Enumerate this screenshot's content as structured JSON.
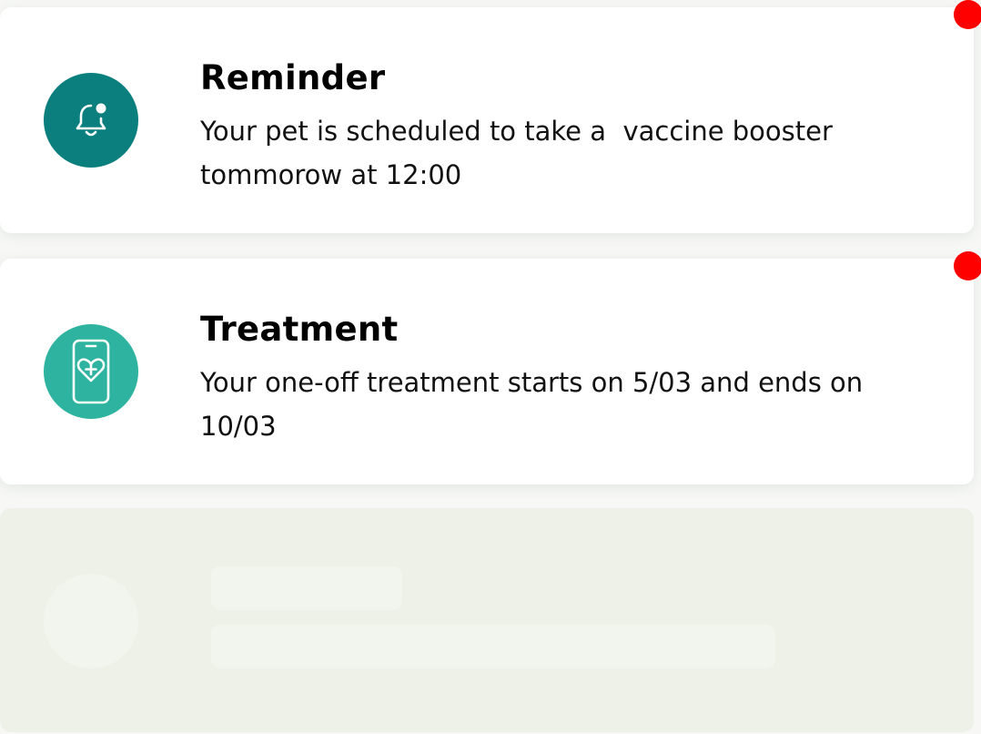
{
  "notifications": [
    {
      "title": "Reminder",
      "body": "Your pet is scheduled to take a  vaccine booster tommorow at 12:00",
      "icon": "bell-icon",
      "icon_color": "#0a7f7e",
      "unread": true
    },
    {
      "title": "Treatment",
      "body": "Your one-off treatment starts on 5/03 and ends on 10/03",
      "icon": "phone-heart-icon",
      "icon_color": "#2db39f",
      "unread": true
    }
  ],
  "placeholder": {
    "state": "loading-skeleton"
  },
  "colors": {
    "unread_dot": "#fe0000",
    "skeleton_bg": "#edf1e8",
    "skeleton_fill": "#f2f5ee"
  }
}
